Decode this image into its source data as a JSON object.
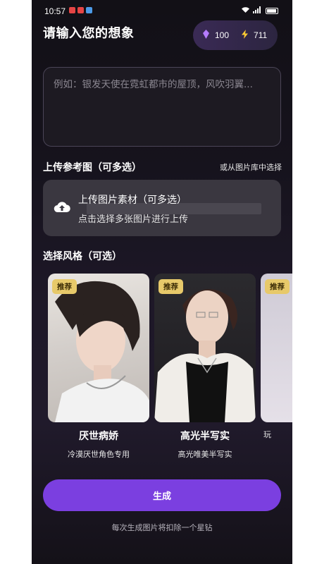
{
  "status": {
    "time": "10:57"
  },
  "header": {
    "title": "请输入您的想象",
    "gems": "100",
    "energy": "711"
  },
  "prompt": {
    "placeholder": "例如：银发天使在霓虹都市的屋顶，风吹羽翼..."
  },
  "upload": {
    "section_title": "上传参考图（可多选）",
    "library_link": "或从图片库中选择",
    "title": "上传图片素材（可多选）",
    "subtitle": "点击选择多张图片进行上传"
  },
  "styles": {
    "section_title": "选择风格（可选）",
    "items": [
      {
        "tag": "推荐",
        "name": "厌世病娇",
        "desc": "冷漠厌世角色专用"
      },
      {
        "tag": "推荐",
        "name": "高光半写实",
        "desc": "高光唯美半写实"
      },
      {
        "tag": "推荐",
        "name": "",
        "desc": "玩"
      }
    ]
  },
  "generate": {
    "label": "生成",
    "note": "每次生成图片将扣除一个星钻"
  },
  "colors": {
    "accent": "#7b3fe0",
    "tag": "#e7c96a",
    "background": "#16131d"
  }
}
